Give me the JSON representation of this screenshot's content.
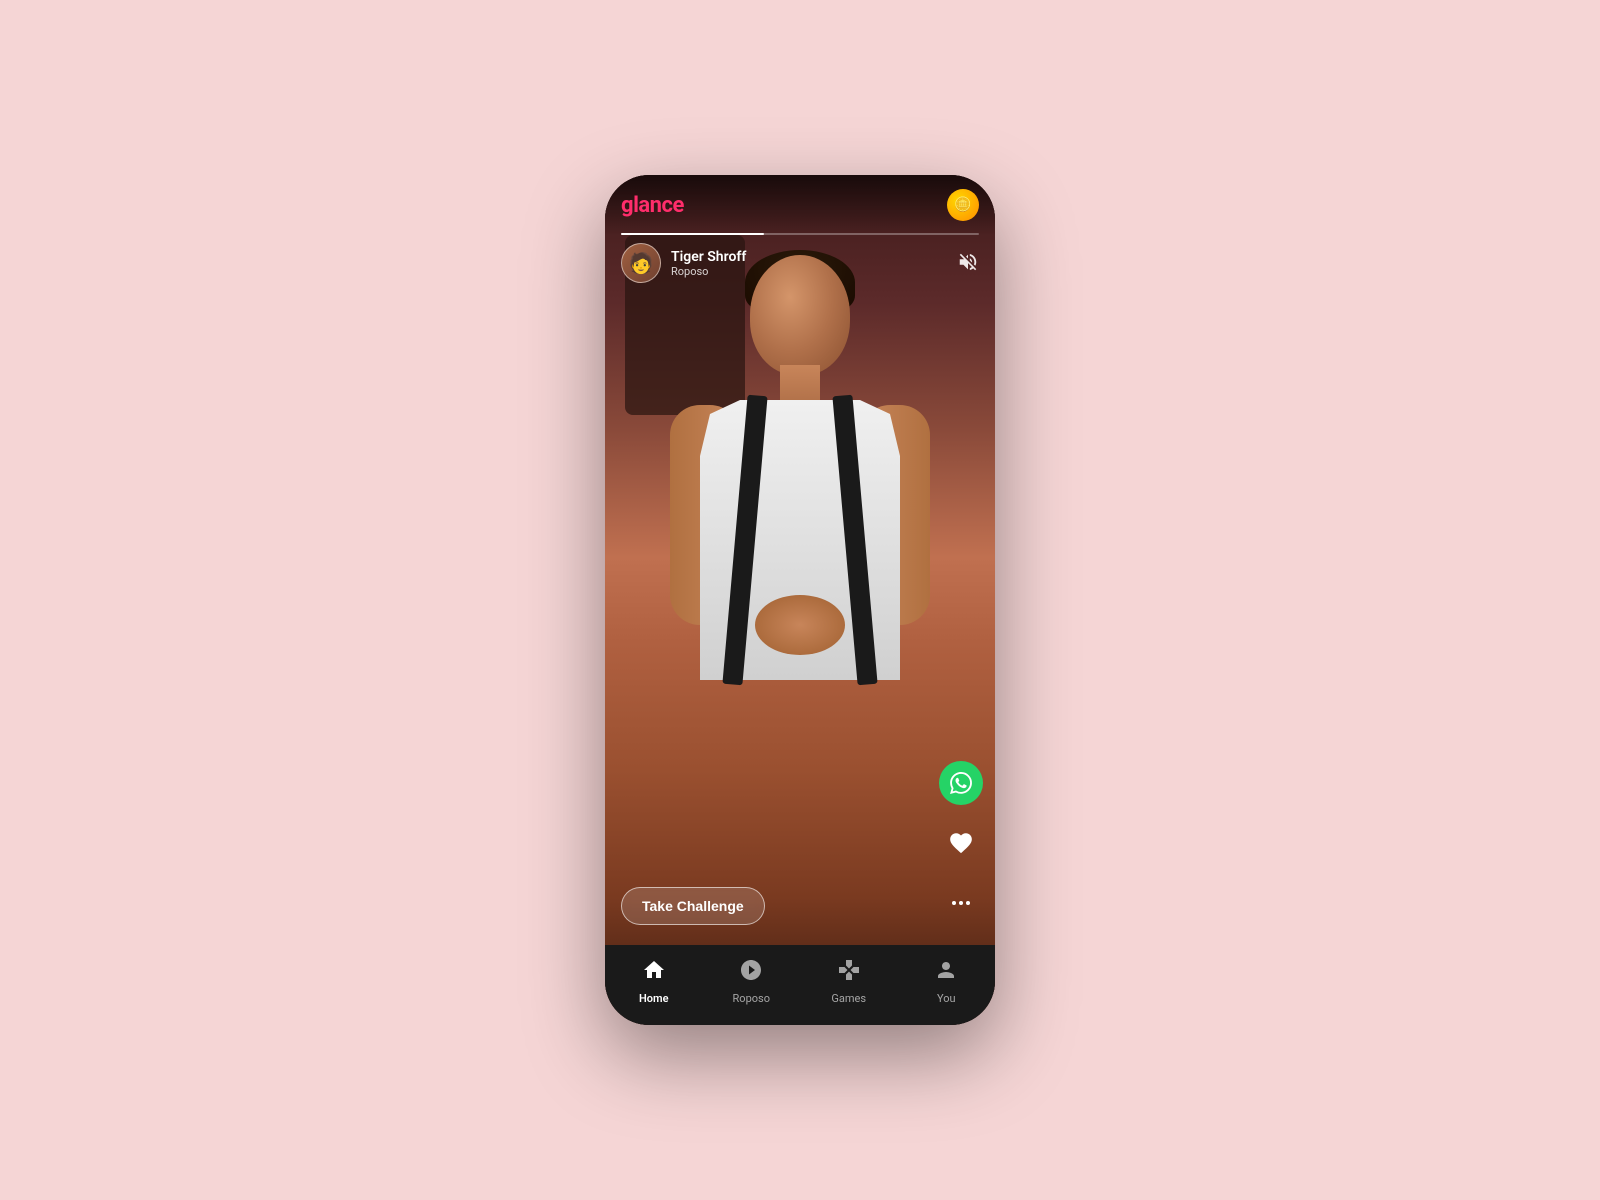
{
  "app": {
    "name": "glance",
    "logo": "glance"
  },
  "header": {
    "logo_text": "glance",
    "coin_icon": "🪙"
  },
  "creator": {
    "name": "Tiger Shroff",
    "source": "Roposo",
    "avatar_emoji": "👤"
  },
  "actions": {
    "whatsapp_icon": "💬",
    "heart_icon": "♡",
    "more_icon": "...",
    "mute_icon": "🔇"
  },
  "challenge_button": {
    "label": "Take Challenge"
  },
  "bottom_nav": {
    "items": [
      {
        "id": "home",
        "label": "Home",
        "icon": "🏠",
        "active": true
      },
      {
        "id": "roposo",
        "label": "Roposo",
        "icon": "◑",
        "active": false
      },
      {
        "id": "games",
        "label": "Games",
        "icon": "🎮",
        "active": false
      },
      {
        "id": "you",
        "label": "You",
        "icon": "👤",
        "active": false
      }
    ]
  },
  "progress": {
    "fill_percent": 40
  }
}
